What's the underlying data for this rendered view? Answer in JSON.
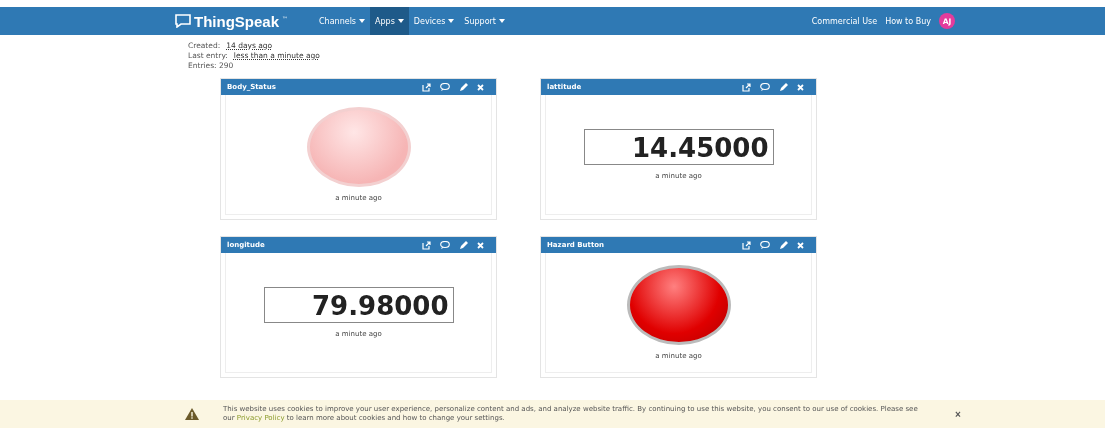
{
  "navbar": {
    "brand": "ThingSpeak",
    "trademark": "™",
    "menu": [
      {
        "label": "Channels",
        "selected": false
      },
      {
        "label": "Apps",
        "selected": true
      },
      {
        "label": "Devices",
        "selected": false
      },
      {
        "label": "Support",
        "selected": false
      }
    ],
    "right_links": [
      "Commercial Use",
      "How to Buy"
    ],
    "avatar": "AJ"
  },
  "channel_info": [
    {
      "label": "Created:",
      "value": "14 days ago"
    },
    {
      "label": "Last entry:",
      "value": "less than a minute ago"
    },
    {
      "label": "Entries: 290"
    }
  ],
  "widgets": [
    {
      "title": "Body_Status",
      "kind": "lamp",
      "on": false,
      "timestamp": "a minute ago"
    },
    {
      "title": "lattitude",
      "kind": "numeric",
      "value": "14.45000",
      "timestamp": "a minute ago"
    },
    {
      "title": "longitude",
      "kind": "numeric",
      "value": "79.98000",
      "timestamp": "a minute ago"
    },
    {
      "title": "Hazard Button",
      "kind": "lamp",
      "on": true,
      "timestamp": "a minute ago"
    }
  ],
  "cookie_banner": {
    "text": "This website uses cookies to improve your user experience, personalize content and ads, and analyze website traffic. By continuing to use this website, you consent to our use of cookies. Please see our",
    "link": "Privacy Policy",
    "text_after": "to learn more about cookies and how to change your settings.",
    "close": "×"
  }
}
